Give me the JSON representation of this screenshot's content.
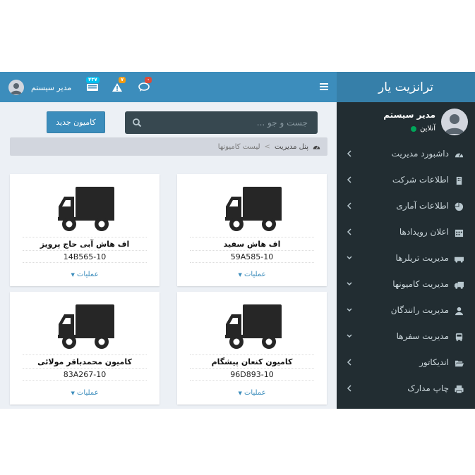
{
  "sidebar": {
    "logo": "ترانزیت یار",
    "user_name": "مدیر سیستم",
    "user_status": "آنلاین",
    "items": [
      {
        "label": "داشبورد مدیریت",
        "icon": "dashboard-icon"
      },
      {
        "label": "اطلاعات شرکت",
        "icon": "building-icon"
      },
      {
        "label": "اطلاعات آماری",
        "icon": "pie-chart-icon"
      },
      {
        "label": "اعلان رویدادها",
        "icon": "calendar-icon"
      },
      {
        "label": "مدیریت تریلرها",
        "icon": "trailer-icon"
      },
      {
        "label": "مدیریت کامیونها",
        "icon": "truck-icon"
      },
      {
        "label": "مدیریت رانندگان",
        "icon": "user-icon"
      },
      {
        "label": "مدیریت سفرها",
        "icon": "bus-icon"
      },
      {
        "label": "اندیکاتور",
        "icon": "folder-open-icon"
      },
      {
        "label": "چاپ مدارک",
        "icon": "print-icon"
      }
    ]
  },
  "header": {
    "user_name": "مدیر سیستم",
    "badges": {
      "messages": "۴۳۷",
      "warnings": "۷",
      "comments": "۰"
    }
  },
  "search": {
    "placeholder": "جست و جو ..."
  },
  "new_button": "کامیون جدید",
  "breadcrumb": {
    "root": "پنل مدیریت",
    "sep": ">",
    "current": "لیست کامیونها"
  },
  "cards": [
    {
      "name": "اف هاش سفید",
      "plate": "59A585-10",
      "ops": "عملیات"
    },
    {
      "name": "اف هاش آبی حاج پرویز",
      "plate": "14B565-10",
      "ops": "عملیات"
    },
    {
      "name": "کامیون کنعان پیشگام",
      "plate": "96D893-10",
      "ops": "عملیات"
    },
    {
      "name": "کامیون محمدباقر مولائی",
      "plate": "83A267-10",
      "ops": "عملیات"
    }
  ],
  "colors": {
    "header": "#3c8dbc",
    "logo": "#367fa9",
    "sidebar": "#222d32",
    "content": "#ecf0f5",
    "accent": "#3c8dbc"
  }
}
